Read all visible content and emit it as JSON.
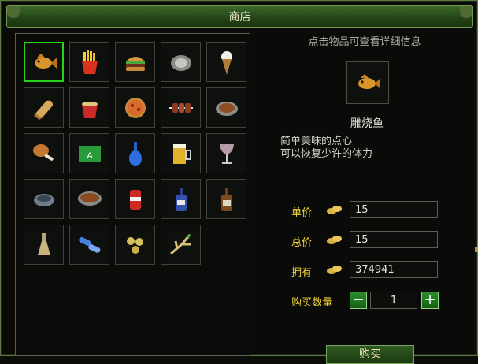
{
  "window": {
    "title": "商店"
  },
  "shop": {
    "items": [
      {
        "icon": "carved-fish-icon"
      },
      {
        "icon": "fries-icon"
      },
      {
        "icon": "burger-icon"
      },
      {
        "icon": "plate-icon"
      },
      {
        "icon": "ice-cream-icon"
      },
      {
        "icon": "bread-icon"
      },
      {
        "icon": "noodle-cup-icon"
      },
      {
        "icon": "pizza-icon"
      },
      {
        "icon": "meat-skewer-icon"
      },
      {
        "icon": "pie-icon"
      },
      {
        "icon": "chicken-leg-icon"
      },
      {
        "icon": "green-card-icon"
      },
      {
        "icon": "blue-bottle-icon"
      },
      {
        "icon": "beer-mug-icon"
      },
      {
        "icon": "wine-glass-icon"
      },
      {
        "icon": "small-bowl-icon"
      },
      {
        "icon": "soup-bowl-icon"
      },
      {
        "icon": "soda-can-icon"
      },
      {
        "icon": "vodka-bottle-icon"
      },
      {
        "icon": "whiskey-bottle-icon"
      },
      {
        "icon": "flask-icon"
      },
      {
        "icon": "pills-icon"
      },
      {
        "icon": "balls-icon"
      },
      {
        "icon": "ginseng-icon"
      }
    ],
    "selected_index": 0
  },
  "detail": {
    "hint": "点击物品可查看详细信息",
    "item_icon": "carved-fish-icon",
    "item_name": "雕烧鱼",
    "desc_line1": "简单美味的点心",
    "desc_line2": "可以恢复少许的体力"
  },
  "purchase": {
    "unit_price_label": "单价",
    "unit_price": "15",
    "total_price_label": "总价",
    "total_price": "15",
    "owned_label": "拥有",
    "owned": "374941",
    "quantity_label": "购买数量",
    "quantity": "1",
    "minus_label": "−",
    "plus_label": "+",
    "coin_icon": "gold-coins-icon",
    "buy_label": "购买"
  },
  "colors": {
    "accent": "#f0d33a",
    "selection": "#26d31d",
    "frame": "#3d6a2a"
  }
}
